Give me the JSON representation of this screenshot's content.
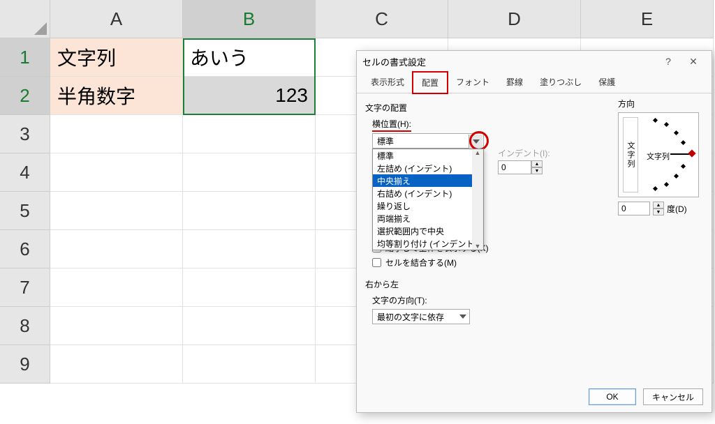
{
  "columns": [
    "A",
    "B",
    "C",
    "D",
    "E"
  ],
  "rows": [
    "1",
    "2",
    "3",
    "4",
    "5",
    "6",
    "7",
    "8",
    "9"
  ],
  "cells": {
    "A1": "文字列",
    "A2": "半角数字",
    "B1": "あいう",
    "B2": "123"
  },
  "dialog": {
    "title": "セルの書式設定",
    "help": "?",
    "close": "✕",
    "tabs": {
      "display": "表示形式",
      "align": "配置",
      "font": "フォント",
      "border": "罫線",
      "fill": "塗りつぶし",
      "protect": "保護"
    },
    "text_align_group": "文字の配置",
    "horizontal_label": "横位置(H):",
    "horizontal_value": "標準",
    "horizontal_options": [
      "標準",
      "左詰め (インデント)",
      "中央揃え",
      "右詰め (インデント)",
      "繰り返し",
      "両端揃え",
      "選択範囲内で中央",
      "均等割り付け (インデント)"
    ],
    "indent_label": "インデント(I):",
    "indent_value": "0",
    "shrink_label": "縮小して全体を表示する(K)",
    "merge_label": "セルを結合する(M)",
    "rtl_group": "右から左",
    "rtl_label": "文字の方向(T):",
    "rtl_value": "最初の文字に依存",
    "orient_group": "方向",
    "orient_vertical": "文字列",
    "orient_horizontal": "文字列",
    "deg_value": "0",
    "deg_label": "度(D)",
    "ok": "OK",
    "cancel": "キャンセル"
  }
}
